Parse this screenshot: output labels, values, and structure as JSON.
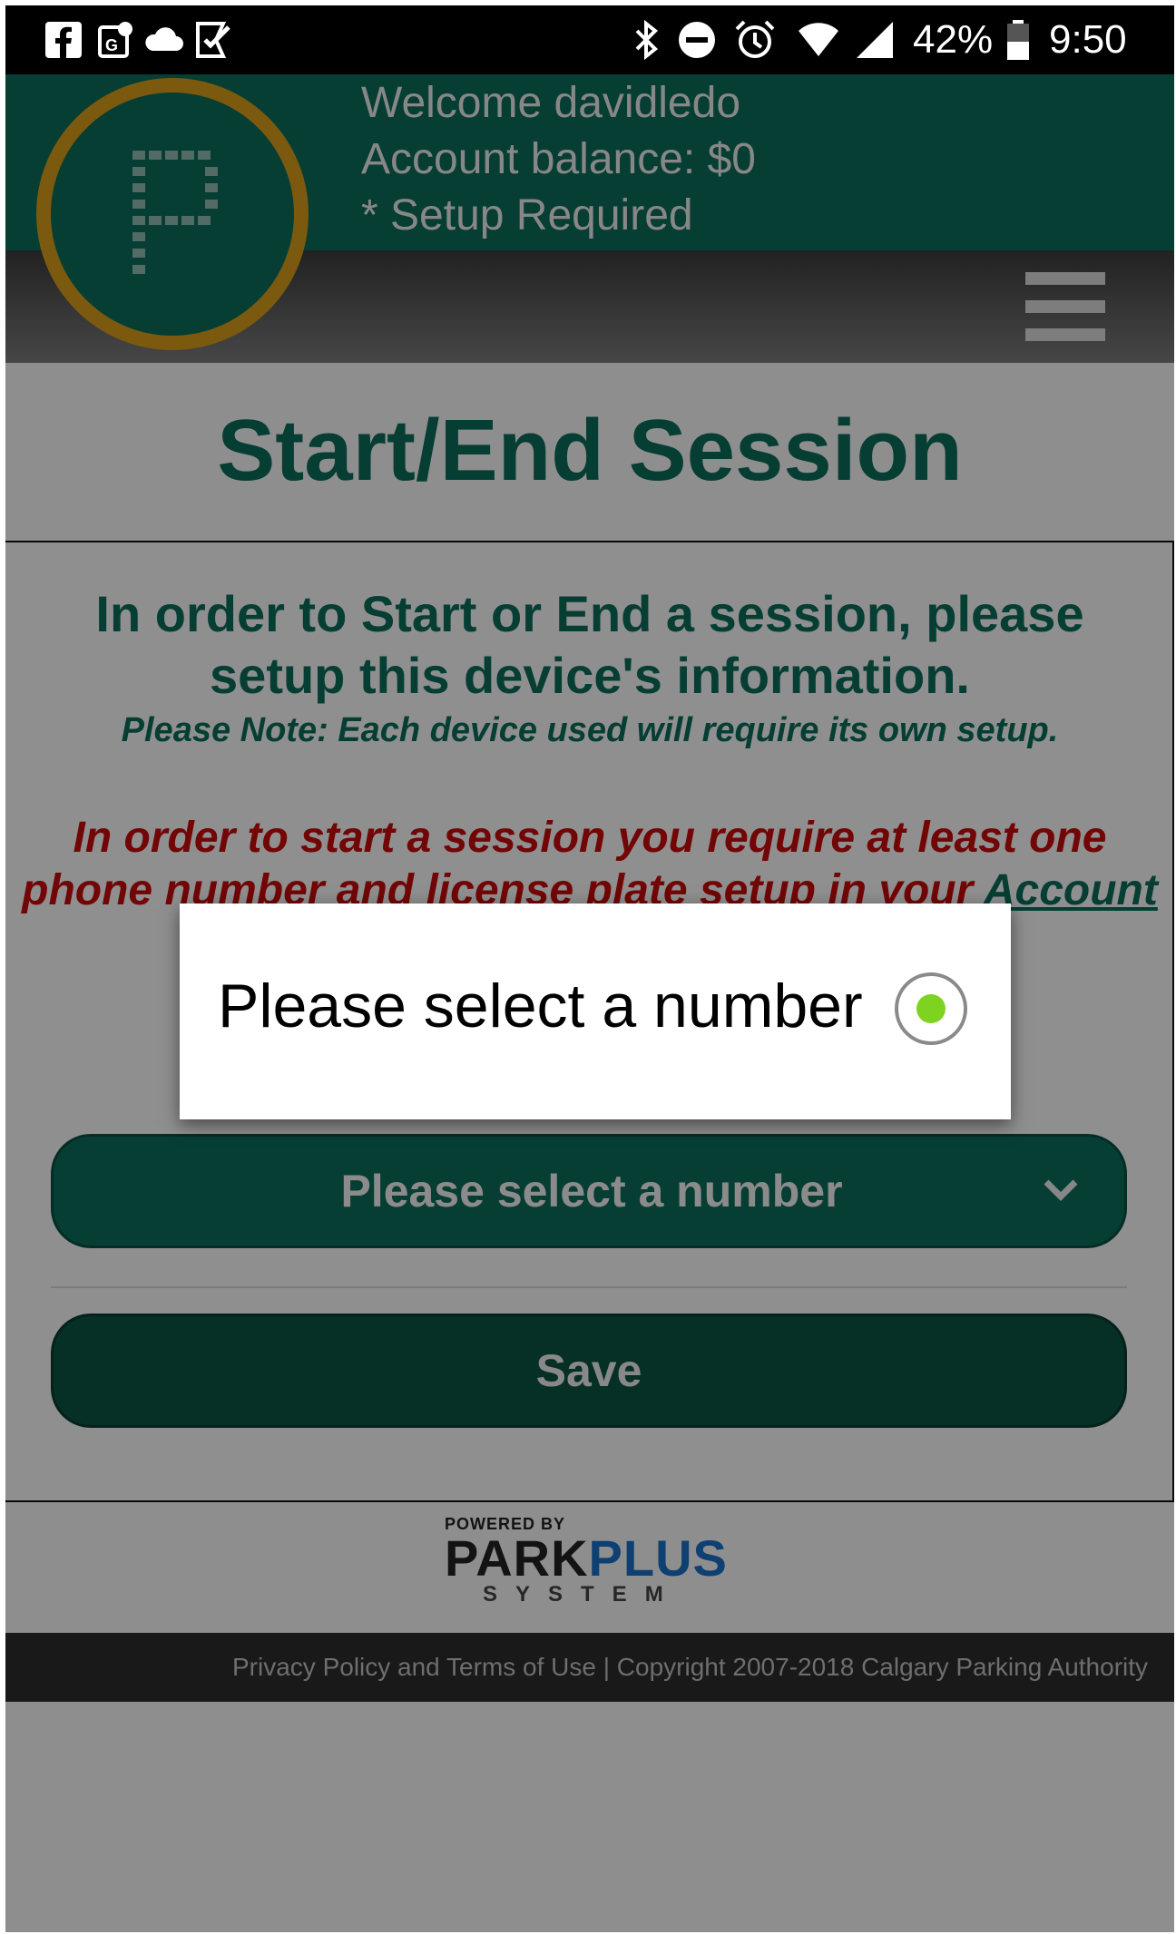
{
  "status_bar": {
    "battery_percent": "42%",
    "time": "9:50",
    "left_icons": [
      "facebook-icon",
      "maps-icon",
      "cloud-icon",
      "tasks-icon"
    ],
    "right_icons": [
      "bluetooth-icon",
      "do-not-disturb-icon",
      "alarm-icon",
      "wifi-icon",
      "signal-icon",
      "battery-icon"
    ]
  },
  "header": {
    "welcome": "Welcome davidledo",
    "balance": "Account balance: $0",
    "setup": "* Setup Required",
    "colors": {
      "primary": "#0c6b5a",
      "ring": "#d49a1a"
    }
  },
  "page": {
    "title": "Start/End Session",
    "intro_line1": "In order to Start or End a session, please",
    "intro_line2": "setup this device's information.",
    "note": "Please Note: Each device used will require its own setup.",
    "warning_line1": "In order to start a session you require at least one",
    "warning_line2_prefix": "phone number and license plate setup in your ",
    "account_link": "Account"
  },
  "form": {
    "phone_select_label": "Please select a number",
    "save_label": "Save"
  },
  "branding": {
    "powered_by": "POWERED BY",
    "park": "PARK",
    "plus": "PLUS",
    "system": "SYSTEM"
  },
  "footer": {
    "text": "Privacy Policy and Terms of Use | Copyright 2007-2018 Calgary Parking Authority"
  },
  "dialog": {
    "option_label": "Please select a number",
    "option_selected": true,
    "accent_color": "#7ed321"
  }
}
